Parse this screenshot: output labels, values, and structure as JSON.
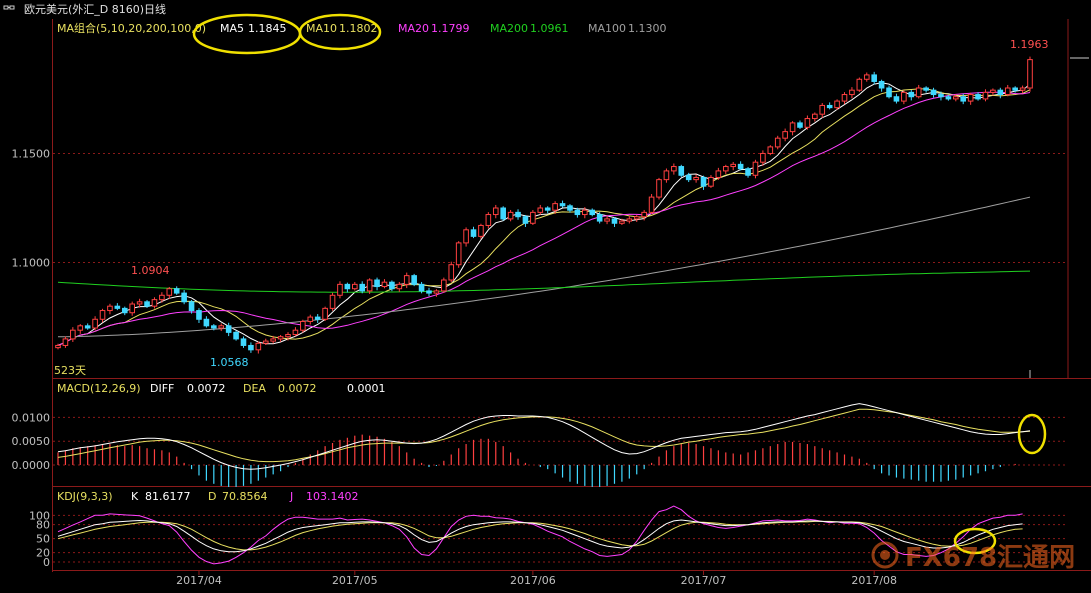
{
  "window": {
    "title": "欧元美元(外汇_D 8160)日线"
  },
  "chart_data": {
    "type": "candlestick",
    "colors": {
      "up": "#ff4040",
      "down": "#40d8ff",
      "ma5": "#ffffff",
      "ma10": "#e8e060",
      "ma20": "#ff40ff",
      "ma200": "#20d020",
      "ma100": "#a0a0a0",
      "diff": "#ffffff",
      "dea": "#e8e060",
      "k": "#ffffff",
      "d": "#e8e060",
      "j": "#ff40ff",
      "annotation": "#f0e000",
      "grid": "#8b1a1a",
      "axis_text": "#c0c0c0"
    },
    "main": {
      "title": "MA组合(5,10,20,200,100,0)",
      "legend": [
        {
          "name": "MA5",
          "value": "1.1845"
        },
        {
          "name": "MA10",
          "value": "1.1802"
        },
        {
          "name": "MA20",
          "value": "1.1799"
        },
        {
          "name": "MA200",
          "value": "1.0961"
        },
        {
          "name": "MA100",
          "value": "1.1300"
        }
      ],
      "yticks": [
        "1.1500",
        "1.1000"
      ],
      "ylim": [
        1.048,
        1.202
      ],
      "high_label": "1.0904",
      "low_label": "1.0568",
      "max_label": "1.1963",
      "days_label": "523天"
    },
    "macd": {
      "title": "MACD(12,26,9)",
      "legend": [
        {
          "name": "DIFF",
          "value": "0.0072"
        },
        {
          "name": "DEA",
          "value": "0.0072"
        },
        {
          "name": "",
          "value": "0.0001"
        }
      ],
      "yticks": [
        "0.0100",
        "0.0050",
        "0.0000"
      ],
      "ylim": [
        -0.004,
        0.0145
      ]
    },
    "kdj": {
      "title": "KDJ(9,3,3)",
      "legend": [
        {
          "name": "K",
          "value": "81.6177"
        },
        {
          "name": "D",
          "value": "70.8564"
        },
        {
          "name": "J",
          "value": "103.1402"
        }
      ],
      "yticks": [
        "100",
        "80",
        "50",
        "20",
        "0"
      ],
      "ylim": [
        -15,
        120
      ]
    },
    "xaxis": [
      "2017/04",
      "2017/05",
      "2017/06",
      "2017/07",
      "2017/08"
    ],
    "month_start_index": [
      19,
      40,
      64,
      87,
      110
    ],
    "close": [
      1.062,
      1.065,
      1.069,
      1.071,
      1.07,
      1.074,
      1.078,
      1.08,
      1.079,
      1.077,
      1.081,
      1.082,
      1.08,
      1.083,
      1.085,
      1.088,
      1.086,
      1.082,
      1.078,
      1.074,
      1.071,
      1.07,
      1.071,
      1.068,
      1.065,
      1.062,
      1.06,
      1.063,
      1.064,
      1.065,
      1.066,
      1.067,
      1.069,
      1.073,
      1.075,
      1.074,
      1.079,
      1.085,
      1.09,
      1.088,
      1.09,
      1.087,
      1.092,
      1.089,
      1.091,
      1.088,
      1.09,
      1.094,
      1.09,
      1.087,
      1.086,
      1.087,
      1.092,
      1.099,
      1.109,
      1.115,
      1.112,
      1.117,
      1.122,
      1.125,
      1.12,
      1.123,
      1.121,
      1.118,
      1.123,
      1.125,
      1.124,
      1.127,
      1.126,
      1.124,
      1.122,
      1.124,
      1.122,
      1.119,
      1.12,
      1.118,
      1.119,
      1.12,
      1.121,
      1.123,
      1.13,
      1.138,
      1.142,
      1.144,
      1.14,
      1.138,
      1.139,
      1.135,
      1.139,
      1.142,
      1.144,
      1.145,
      1.143,
      1.14,
      1.146,
      1.15,
      1.153,
      1.157,
      1.16,
      1.164,
      1.162,
      1.166,
      1.168,
      1.172,
      1.171,
      1.174,
      1.177,
      1.179,
      1.184,
      1.186,
      1.183,
      1.18,
      1.176,
      1.174,
      1.178,
      1.176,
      1.18,
      1.179,
      1.177,
      1.176,
      1.175,
      1.176,
      1.174,
      1.177,
      1.175,
      1.178,
      1.179,
      1.177,
      1.18,
      1.179,
      1.18,
      1.193
    ],
    "macd_hist": [
      0.0012,
      0.0014,
      0.0016,
      0.0017,
      0.0018,
      0.0019,
      0.002,
      0.002,
      0.0019,
      0.0018,
      0.0019,
      0.0018,
      0.0016,
      0.0015,
      0.0014,
      0.0012,
      0.0008,
      0.0002,
      -0.0004,
      -0.001,
      -0.0015,
      -0.0018,
      -0.002,
      -0.0021,
      -0.0021,
      -0.002,
      -0.0018,
      -0.0015,
      -0.0012,
      -0.0009,
      -0.0006,
      -0.0002,
      0.0002,
      0.0006,
      0.001,
      0.0014,
      0.0018,
      0.0021,
      0.0024,
      0.0026,
      0.0028,
      0.0029,
      0.0028,
      0.0027,
      0.0025,
      0.0022,
      0.0018,
      0.0012,
      0.0006,
      0.0002,
      -0.0002,
      -0.0001,
      0.0004,
      0.001,
      0.0016,
      0.002,
      0.0024,
      0.0025,
      0.0025,
      0.0022,
      0.0018,
      0.0012,
      0.0006,
      0.0002,
      0.0,
      -0.0002,
      -0.0004,
      -0.0008,
      -0.0012,
      -0.0016,
      -0.0018,
      -0.002,
      -0.0021,
      -0.0021,
      -0.002,
      -0.0018,
      -0.0016,
      -0.0013,
      -0.0009,
      -0.0004,
      0.0002,
      0.0008,
      0.0014,
      0.0018,
      0.002,
      0.0021,
      0.002,
      0.0018,
      0.0016,
      0.0014,
      0.0012,
      0.0011,
      0.001,
      0.0012,
      0.0014,
      0.0016,
      0.0018,
      0.002,
      0.0022,
      0.0022,
      0.0021,
      0.002,
      0.0018,
      0.0016,
      0.0014,
      0.0012,
      0.001,
      0.0008,
      0.0006,
      0.0002,
      -0.0004,
      -0.0008,
      -0.001,
      -0.0012,
      -0.0013,
      -0.0014,
      -0.0015,
      -0.0016,
      -0.0016,
      -0.0016,
      -0.0015,
      -0.0014,
      -0.0012,
      -0.001,
      -0.0008,
      -0.0006,
      -0.0004,
      -0.0002,
      0.0,
      0.0001
    ],
    "macd_diff": [
      0.0028,
      0.003,
      0.0033,
      0.0036,
      0.0038,
      0.004,
      0.0043,
      0.0046,
      0.0049,
      0.0051,
      0.0053,
      0.0055,
      0.0056,
      0.0056,
      0.0055,
      0.0053,
      0.0049,
      0.0043,
      0.0036,
      0.0028,
      0.002,
      0.0012,
      0.0005,
      -0.0001,
      -0.0005,
      -0.0008,
      -0.0009,
      -0.0008,
      -0.0006,
      -0.0003,
      0.0,
      0.0003,
      0.0007,
      0.0011,
      0.0016,
      0.0021,
      0.0026,
      0.0031,
      0.0036,
      0.0041,
      0.0046,
      0.005,
      0.0052,
      0.0053,
      0.0052,
      0.005,
      0.0048,
      0.0046,
      0.0045,
      0.0046,
      0.0049,
      0.0054,
      0.0061,
      0.0069,
      0.0077,
      0.0085,
      0.0092,
      0.0097,
      0.0101,
      0.0103,
      0.0104,
      0.0104,
      0.0103,
      0.0103,
      0.0103,
      0.0102,
      0.01,
      0.0096,
      0.0091,
      0.0084,
      0.0076,
      0.0067,
      0.0058,
      0.0049,
      0.004,
      0.0032,
      0.0026,
      0.0023,
      0.0024,
      0.0028,
      0.0034,
      0.0041,
      0.0047,
      0.0052,
      0.0056,
      0.0058,
      0.006,
      0.0062,
      0.0064,
      0.0066,
      0.0068,
      0.0069,
      0.007,
      0.0072,
      0.0075,
      0.0079,
      0.0083,
      0.0087,
      0.0091,
      0.0095,
      0.0099,
      0.0103,
      0.0106,
      0.011,
      0.0114,
      0.0118,
      0.0122,
      0.0126,
      0.0129,
      0.0126,
      0.0122,
      0.0118,
      0.0114,
      0.011,
      0.0106,
      0.0102,
      0.0098,
      0.0094,
      0.009,
      0.0086,
      0.0082,
      0.0078,
      0.0074,
      0.007,
      0.0067,
      0.0065,
      0.0064,
      0.0064,
      0.0066,
      0.0068,
      0.007,
      0.0072
    ],
    "macd_dea": [
      0.0016,
      0.0018,
      0.0021,
      0.0024,
      0.0027,
      0.003,
      0.0033,
      0.0036,
      0.0039,
      0.0042,
      0.0045,
      0.0048,
      0.005,
      0.0051,
      0.0052,
      0.0052,
      0.0051,
      0.0049,
      0.0046,
      0.0042,
      0.0037,
      0.0032,
      0.0027,
      0.0022,
      0.0017,
      0.0013,
      0.001,
      0.0008,
      0.0007,
      0.0007,
      0.0008,
      0.0009,
      0.0011,
      0.0014,
      0.0017,
      0.002,
      0.0024,
      0.0028,
      0.0032,
      0.0036,
      0.0039,
      0.0042,
      0.0044,
      0.0045,
      0.0046,
      0.0046,
      0.0046,
      0.0046,
      0.0046,
      0.0046,
      0.0047,
      0.005,
      0.0054,
      0.0059,
      0.0065,
      0.0071,
      0.0077,
      0.0083,
      0.0088,
      0.0092,
      0.0095,
      0.0097,
      0.0099,
      0.01,
      0.0101,
      0.0101,
      0.0101,
      0.01,
      0.0098,
      0.0095,
      0.0091,
      0.0086,
      0.008,
      0.0073,
      0.0066,
      0.0059,
      0.0052,
      0.0046,
      0.0042,
      0.004,
      0.0039,
      0.0039,
      0.004,
      0.0042,
      0.0045,
      0.0048,
      0.005,
      0.0053,
      0.0055,
      0.0058,
      0.006,
      0.0062,
      0.0064,
      0.0065,
      0.0067,
      0.0069,
      0.0072,
      0.0075,
      0.0078,
      0.0082,
      0.0085,
      0.0089,
      0.0093,
      0.0097,
      0.0101,
      0.0105,
      0.0109,
      0.0113,
      0.0117,
      0.0117,
      0.0116,
      0.0114,
      0.0112,
      0.011,
      0.0107,
      0.0104,
      0.0101,
      0.0098,
      0.0095,
      0.0091,
      0.0088,
      0.0085,
      0.0081,
      0.0078,
      0.0075,
      0.0073,
      0.0071,
      0.0069,
      0.0069,
      0.0069,
      0.007,
      0.0071
    ],
    "kdj_k": [
      55,
      60,
      65,
      70,
      75,
      80,
      82,
      85,
      86,
      87,
      88,
      89,
      88,
      86,
      84,
      82,
      76,
      66,
      55,
      44,
      35,
      28,
      24,
      22,
      22,
      24,
      28,
      34,
      40,
      48,
      56,
      64,
      70,
      74,
      76,
      78,
      80,
      82,
      84,
      84,
      85,
      86,
      86,
      85,
      84,
      82,
      78,
      70,
      58,
      48,
      42,
      44,
      52,
      62,
      70,
      76,
      80,
      82,
      84,
      85,
      86,
      86,
      85,
      84,
      83,
      80,
      76,
      72,
      68,
      62,
      56,
      50,
      44,
      38,
      34,
      32,
      30,
      32,
      38,
      48,
      60,
      72,
      82,
      88,
      90,
      88,
      86,
      84,
      82,
      80,
      78,
      78,
      79,
      80,
      82,
      84,
      85,
      86,
      86,
      86,
      87,
      88,
      88,
      87,
      86,
      86,
      85,
      85,
      84,
      80,
      74,
      66,
      58,
      50,
      44,
      40,
      36,
      32,
      30,
      30,
      32,
      36,
      42,
      50,
      58,
      64,
      70,
      74,
      78,
      80,
      81.6
    ],
    "kdj_d": [
      50,
      54,
      58,
      62,
      66,
      70,
      73,
      76,
      78,
      80,
      82,
      84,
      85,
      85,
      85,
      84,
      82,
      77,
      70,
      61,
      52,
      44,
      37,
      32,
      28,
      26,
      26,
      28,
      32,
      37,
      43,
      50,
      57,
      63,
      67,
      71,
      74,
      77,
      79,
      81,
      82,
      83,
      84,
      84,
      84,
      84,
      82,
      78,
      72,
      64,
      56,
      52,
      52,
      55,
      60,
      65,
      70,
      74,
      77,
      80,
      82,
      83,
      84,
      84,
      84,
      83,
      81,
      78,
      75,
      71,
      66,
      61,
      55,
      50,
      45,
      41,
      37,
      35,
      35,
      38,
      45,
      54,
      63,
      72,
      79,
      83,
      85,
      85,
      84,
      83,
      81,
      80,
      80,
      80,
      81,
      82,
      83,
      84,
      85,
      85,
      86,
      86,
      87,
      87,
      87,
      86,
      86,
      86,
      85,
      83,
      80,
      76,
      70,
      64,
      58,
      52,
      47,
      42,
      38,
      35,
      34,
      34,
      36,
      40,
      46,
      52,
      58,
      63,
      67,
      70,
      70.9
    ],
    "kdj_j": [
      65,
      72,
      79,
      86,
      93,
      100,
      100,
      103,
      102,
      101,
      100,
      99,
      94,
      88,
      82,
      78,
      64,
      44,
      25,
      10,
      1,
      -4,
      -2,
      2,
      10,
      20,
      32,
      46,
      56,
      70,
      82,
      92,
      96,
      96,
      94,
      92,
      92,
      92,
      94,
      90,
      91,
      92,
      90,
      87,
      84,
      78,
      70,
      54,
      30,
      16,
      14,
      28,
      52,
      76,
      90,
      98,
      100,
      98,
      98,
      95,
      94,
      92,
      87,
      84,
      81,
      74,
      66,
      60,
      54,
      44,
      36,
      28,
      22,
      14,
      12,
      14,
      16,
      26,
      44,
      68,
      90,
      108,
      112,
      120,
      112,
      98,
      88,
      82,
      78,
      74,
      72,
      74,
      77,
      80,
      84,
      88,
      89,
      90,
      88,
      88,
      89,
      92,
      90,
      87,
      84,
      86,
      83,
      83,
      82,
      74,
      62,
      46,
      34,
      22,
      16,
      16,
      14,
      12,
      14,
      20,
      28,
      40,
      54,
      70,
      82,
      88,
      94,
      96,
      100,
      100,
      103.1
    ]
  },
  "watermark": {
    "text": "FX678汇通网"
  }
}
